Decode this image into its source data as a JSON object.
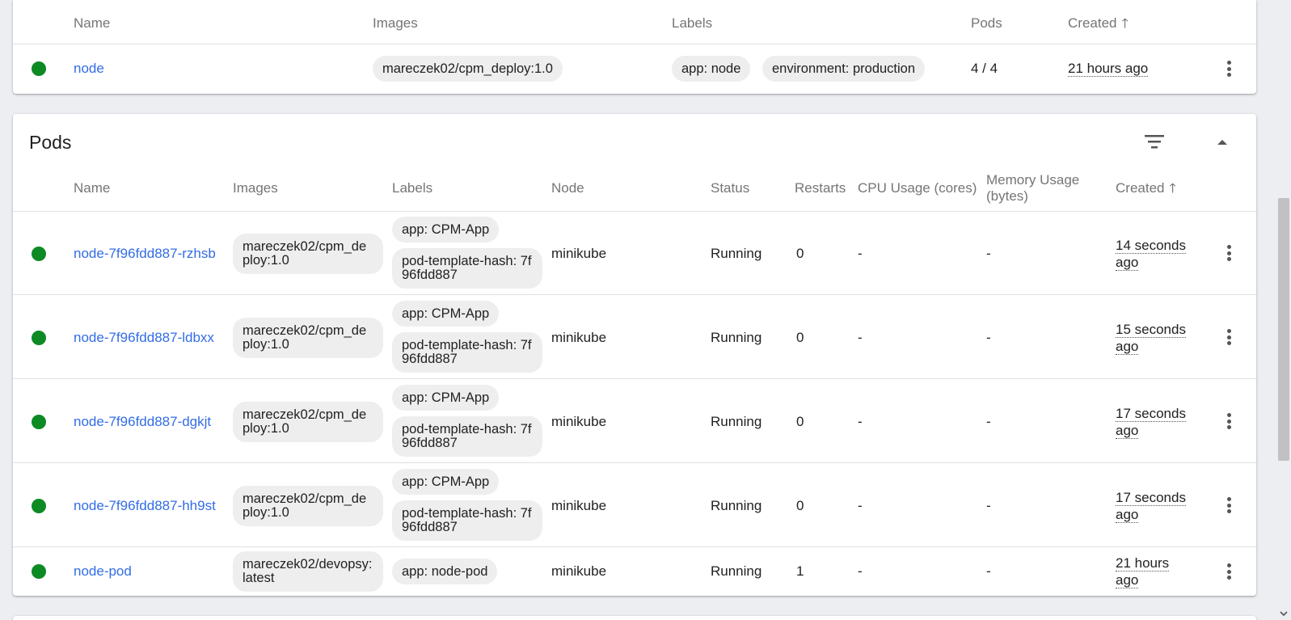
{
  "deployments": {
    "headers": {
      "name": "Name",
      "images": "Images",
      "labels": "Labels",
      "pods": "Pods",
      "created": "Created"
    },
    "row": {
      "name": "node",
      "image": "mareczek02/cpm_deploy:1.0",
      "labels": [
        "app: node",
        "environment: production"
      ],
      "pods": "4 / 4",
      "created": "21 hours ago",
      "status_color": "#0d8a24"
    }
  },
  "pods": {
    "title": "Pods",
    "headers": {
      "name": "Name",
      "images": "Images",
      "labels": "Labels",
      "node": "Node",
      "status": "Status",
      "restarts": "Restarts",
      "cpu": "CPU Usage (cores)",
      "memory_line1": "Memory Usage",
      "memory_line2": "(bytes)",
      "created": "Created"
    },
    "rows": [
      {
        "name": "node-7f96fdd887-rzhsb",
        "image": "mareczek02/cpm_deploy:1.0",
        "label1": "app: CPM-App",
        "label2": "pod-template-hash: 7f96fdd887",
        "node": "minikube",
        "status": "Running",
        "restarts": "0",
        "cpu": "-",
        "memory": "-",
        "created": "14 seconds ago"
      },
      {
        "name": "node-7f96fdd887-ldbxx",
        "image": "mareczek02/cpm_deploy:1.0",
        "label1": "app: CPM-App",
        "label2": "pod-template-hash: 7f96fdd887",
        "node": "minikube",
        "status": "Running",
        "restarts": "0",
        "cpu": "-",
        "memory": "-",
        "created": "15 seconds ago"
      },
      {
        "name": "node-7f96fdd887-dgkjt",
        "image": "mareczek02/cpm_deploy:1.0",
        "label1": "app: CPM-App",
        "label2": "pod-template-hash: 7f96fdd887",
        "node": "minikube",
        "status": "Running",
        "restarts": "0",
        "cpu": "-",
        "memory": "-",
        "created": "17 seconds ago"
      },
      {
        "name": "node-7f96fdd887-hh9st",
        "image": "mareczek02/cpm_deploy:1.0",
        "label1": "app: CPM-App",
        "label2": "pod-template-hash: 7f96fdd887",
        "node": "minikube",
        "status": "Running",
        "restarts": "0",
        "cpu": "-",
        "memory": "-",
        "created": "17 seconds ago"
      },
      {
        "name": "node-pod",
        "image": "mareczek02/devopsy:latest",
        "label1": "app: node-pod",
        "node": "minikube",
        "status": "Running",
        "restarts": "1",
        "cpu": "-",
        "memory": "-",
        "created": "21 hours ago"
      }
    ]
  },
  "icons": [
    "status-running-icon",
    "filter-icon",
    "collapse-icon",
    "more-vert-icon",
    "sort-arrow-up-icon"
  ]
}
